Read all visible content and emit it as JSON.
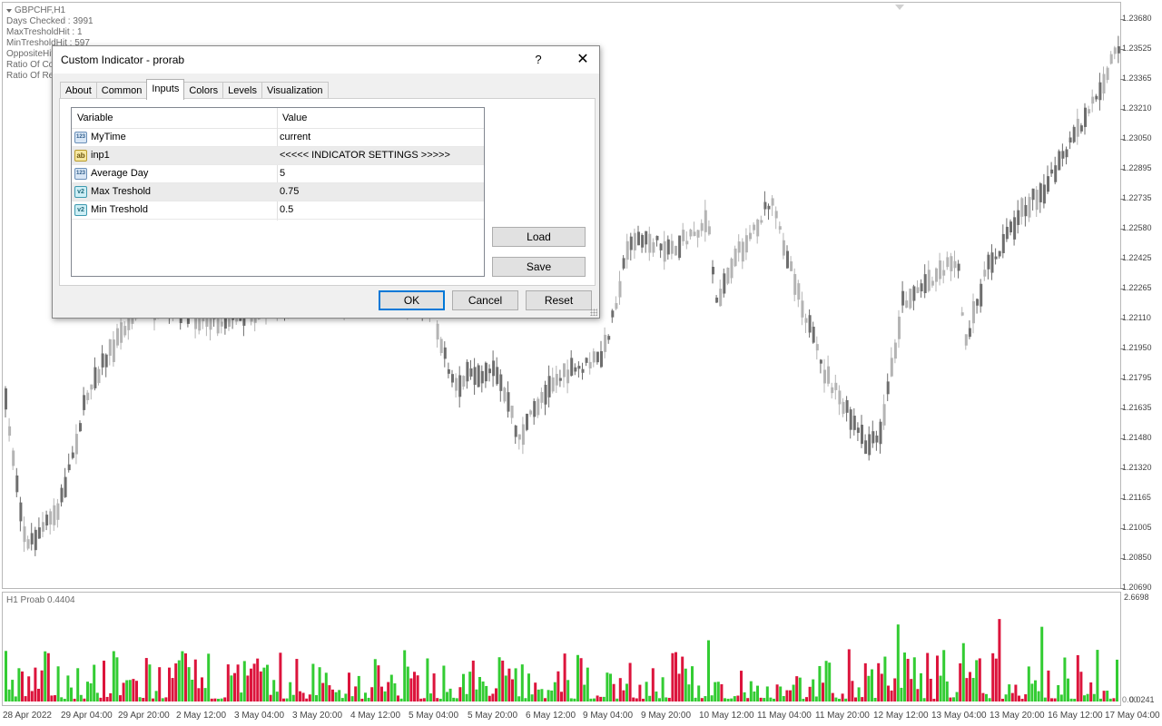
{
  "chart": {
    "symbol_label": "GBPCHF,H1",
    "info_lines": [
      "Days Checked :  3991",
      "MaxTresholdHit : 1",
      "MinTresholdHit : 597",
      "OppositeHit",
      "Ratio Of Co",
      "Ratio Of Re"
    ],
    "price_ticks": [
      "1.23680",
      "1.23525",
      "1.23365",
      "1.23210",
      "1.23050",
      "1.22895",
      "1.22735",
      "1.22580",
      "1.22425",
      "1.22265",
      "1.22110",
      "1.21950",
      "1.21795",
      "1.21635",
      "1.21480",
      "1.21320",
      "1.21165",
      "1.21005",
      "1.20850",
      "1.20690"
    ],
    "time_ticks": [
      "28 Apr 2022",
      "29 Apr 04:00",
      "29 Apr 20:00",
      "2 May 12:00",
      "3 May 04:00",
      "3 May 20:00",
      "4 May 12:00",
      "5 May 04:00",
      "5 May 20:00",
      "6 May 12:00",
      "9 May 04:00",
      "9 May 20:00",
      "10 May 12:00",
      "11 May 04:00",
      "11 May 20:00",
      "12 May 12:00",
      "13 May 04:00",
      "13 May 20:00",
      "16 May 12:00",
      "17 May 04:00"
    ],
    "colors": {
      "bull_candle": "#b4b4b4",
      "bear_candle": "#6e6e6e",
      "hist_green": "#33cc33",
      "hist_red": "#dc143c"
    }
  },
  "subwindow": {
    "title": "H1 Proab  0.4404",
    "axis_top": "2.6698",
    "axis_bottom": "0.0241",
    "axis_bottom_overlap": "0.00"
  },
  "dialog": {
    "title": "Custom Indicator - prorab",
    "help_glyph": "?",
    "close_glyph": "✕",
    "tabs": [
      "About",
      "Common",
      "Inputs",
      "Colors",
      "Levels",
      "Visualization"
    ],
    "active_tab": "Inputs",
    "columns": {
      "variable": "Variable",
      "value": "Value"
    },
    "params": [
      {
        "type": "123",
        "name": "MyTime",
        "value": "current"
      },
      {
        "type": "ab",
        "name": "inp1",
        "value": "<<<<< INDICATOR SETTINGS >>>>>"
      },
      {
        "type": "123",
        "name": "Average Day",
        "value": "5"
      },
      {
        "type": "v2",
        "name": "Max Treshold",
        "value": "0.75"
      },
      {
        "type": "v2",
        "name": "Min Treshold",
        "value": "0.5"
      }
    ],
    "buttons": {
      "load": "Load",
      "save": "Save",
      "ok": "OK",
      "cancel": "Cancel",
      "reset": "Reset"
    }
  }
}
